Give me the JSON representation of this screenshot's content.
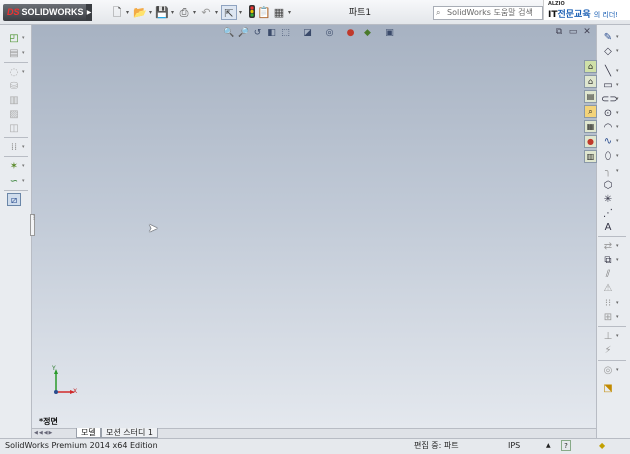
{
  "app": {
    "logo_brand": "DS",
    "logo_text": "SOLIDWORKS",
    "document_title": "파트1"
  },
  "toolbar": {
    "new_icon": "new-document-icon",
    "open_icon": "open-folder-icon",
    "save_icon": "save-icon",
    "print_icon": "print-icon",
    "undo_icon": "undo-icon",
    "select_icon": "select-cursor-icon",
    "rebuild_icon": "rebuild-traffic-light-icon",
    "file_properties_icon": "file-properties-icon",
    "options_icon": "options-icon"
  },
  "search": {
    "placeholder": "SolidWorks 도움말 검색"
  },
  "brand_banner": {
    "small": "ALZIO",
    "main_prefix": "IT",
    "main_highlight": "전문교육",
    "suffix": "의 리더!"
  },
  "heads_up_toolbar": [
    "zoom-to-fit-icon",
    "zoom-area-icon",
    "previous-view-icon",
    "section-view-icon",
    "view-orientation-icon",
    "display-style-icon",
    "hide-show-items-icon",
    "edit-appearance-icon",
    "apply-scene-icon",
    "view-settings-icon"
  ],
  "window_controls": [
    "restore-icon",
    "tile-icon",
    "close-icon"
  ],
  "left_toolbar": [
    "extruded-boss-icon",
    "revolved-boss-icon",
    "swept-boss-icon",
    "lofted-boss-icon",
    "boundary-boss-icon",
    "extruded-cut-icon",
    "fillet-icon",
    "linear-pattern-icon",
    "reference-geometry-icon",
    "curves-icon",
    "instant3d-icon"
  ],
  "right_toolbar": [
    "sketch-icon",
    "smart-dimension-icon",
    "line-icon",
    "rectangle-icon",
    "slot-icon",
    "circle-icon",
    "arc-icon",
    "spline-icon",
    "ellipse-icon",
    "fillet-sketch-icon",
    "polygon-icon",
    "point-icon",
    "centerline-icon",
    "text-icon",
    "convert-entities-icon",
    "offset-entities-icon",
    "mirror-entities-icon",
    "trim-entities-icon",
    "linear-sketch-pattern-icon",
    "move-entities-icon",
    "display-relations-icon",
    "repair-sketch-icon",
    "quick-snaps-icon",
    "rapid-sketch-icon"
  ],
  "task_pane": [
    "solidworks-resources-icon",
    "design-library-icon",
    "file-explorer-icon",
    "search-icon",
    "view-palette-icon",
    "appearances-icon",
    "custom-properties-icon"
  ],
  "viewport": {
    "view_label": "*정면",
    "triad_x": "X",
    "triad_y": "Y"
  },
  "tabs": [
    {
      "label": "모델",
      "active": true
    },
    {
      "label": "모션 스터디 1",
      "active": false
    }
  ],
  "status_bar": {
    "edition": "SolidWorks Premium 2014 x64 Edition",
    "edit_mode": "편집 중: 파트",
    "units": "IPS"
  },
  "colors": {
    "viewport_top": "#a7b2c2",
    "viewport_bottom": "#e4e8ee",
    "logo_bg": "#3a3d42",
    "brand_accent": "#1a5fb4"
  }
}
